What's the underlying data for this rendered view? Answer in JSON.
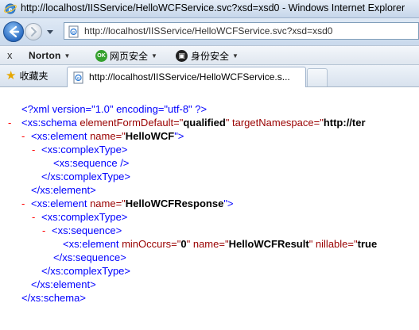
{
  "window": {
    "title": "http://localhost/IISService/HelloWCFService.svc?xsd=xsd0 - Windows Internet Explorer"
  },
  "address_bar": {
    "url": "http://localhost/IISService/HelloWCFService.svc?xsd=xsd0"
  },
  "toolbar": {
    "close_glyph": "x",
    "norton_label": "Norton",
    "safe_web_label": "网页安全",
    "identity_label": "身份安全",
    "dropdown_glyph": "▼"
  },
  "favorites": {
    "label": "收藏夹"
  },
  "tab": {
    "title": "http://localhost/IISService/HelloWCFService.s..."
  },
  "xml": {
    "declaration": "<?xml version=\"1.0\" encoding=\"utf-8\" ?>",
    "collapse_marker": "-",
    "schema_open": {
      "tag": "<xs:schema",
      "attr1_name": " elementFormDefault=\"",
      "attr1_value": "qualified",
      "attr2_name": "\" targetNamespace=\"",
      "attr2_value": "http://ter"
    },
    "element1_open": {
      "tag": "<xs:element",
      "attr_name": " name=\"",
      "attr_value": "HelloWCF",
      "end": "\">"
    },
    "complex_type_open": "<xs:complexType>",
    "sequence_empty": "<xs:sequence />",
    "complex_type_close": "</xs:complexType>",
    "element_close": "</xs:element>",
    "element2_open": {
      "tag": "<xs:element",
      "attr_name": " name=\"",
      "attr_value": "HelloWCFResponse",
      "end": "\">"
    },
    "sequence_open": "<xs:sequence>",
    "inner_element": {
      "tag": "<xs:element",
      "attr1_name": " minOccurs=\"",
      "attr1_value": "0",
      "attr2_name": "\" name=\"",
      "attr2_value": "HelloWCFResult",
      "attr3_name": "\" nillable=\"",
      "attr3_value": "true"
    },
    "sequence_close": "</xs:sequence>",
    "schema_close": "</xs:schema>"
  }
}
